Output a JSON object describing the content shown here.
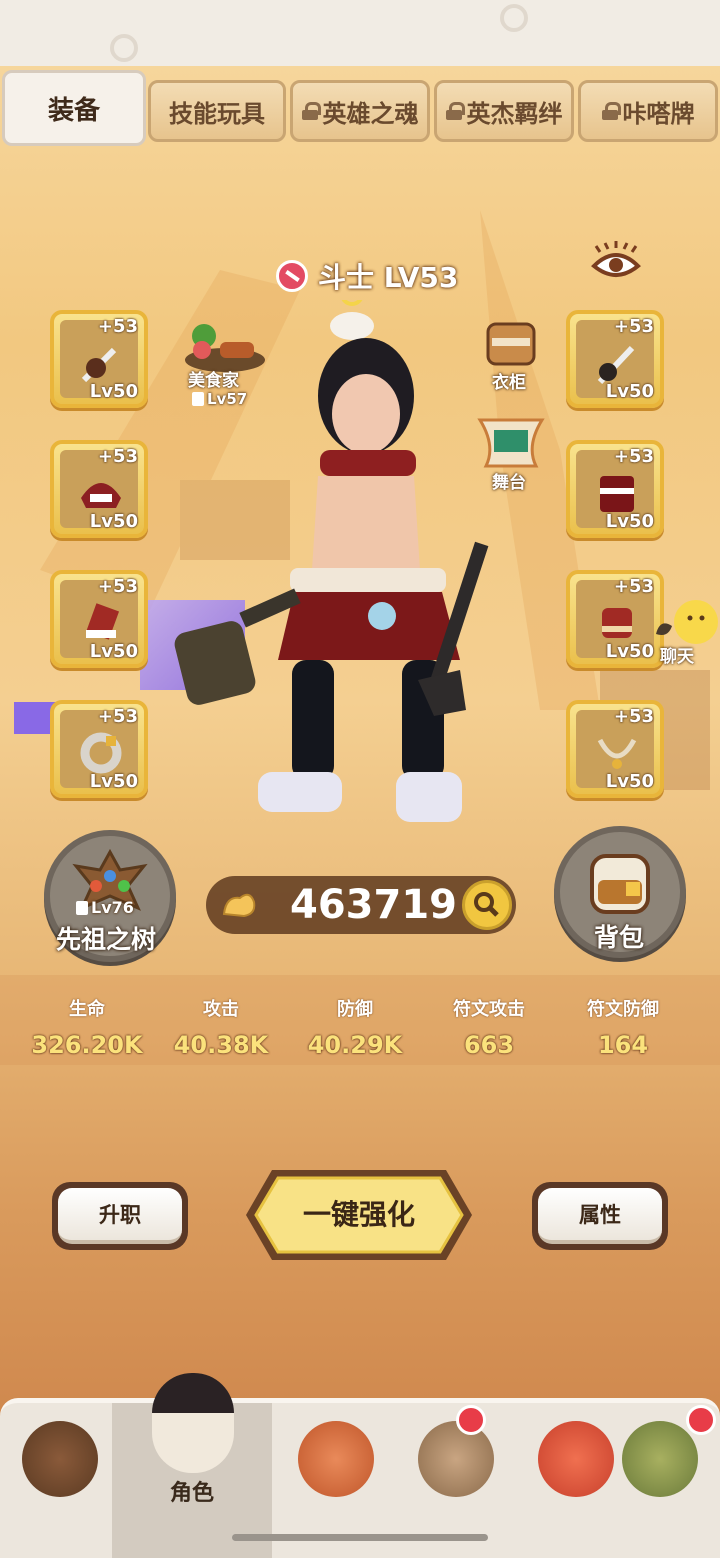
{
  "tabs": [
    {
      "label": "装备",
      "locked": false,
      "active": true
    },
    {
      "label": "技能玩具",
      "locked": false,
      "active": false
    },
    {
      "label": "英雄之魂",
      "locked": true,
      "active": false
    },
    {
      "label": "英杰羁绊",
      "locked": true,
      "active": false
    },
    {
      "label": "咔嗒牌",
      "locked": true,
      "active": false
    }
  ],
  "hero": {
    "class_level": "斗士 LV53"
  },
  "left_slots": [
    {
      "plus": "+53",
      "level": "Lv50",
      "icon": "mace-icon"
    },
    {
      "plus": "+53",
      "level": "Lv50",
      "icon": "helmet-icon"
    },
    {
      "plus": "+53",
      "level": "Lv50",
      "icon": "boots-icon"
    },
    {
      "plus": "+53",
      "level": "Lv50",
      "icon": "ring-icon"
    }
  ],
  "right_slots": [
    {
      "plus": "+53",
      "level": "Lv50",
      "icon": "axe-icon"
    },
    {
      "plus": "+53",
      "level": "Lv50",
      "icon": "armor-icon"
    },
    {
      "plus": "+53",
      "level": "Lv50",
      "icon": "gauntlet-icon"
    },
    {
      "plus": "+53",
      "level": "Lv50",
      "icon": "amulet-icon"
    }
  ],
  "side_features": {
    "gourmet": {
      "label": "美食家",
      "lock_level": "Lv57"
    },
    "wardrobe": {
      "label": "衣柜"
    },
    "stage": {
      "label": "舞台"
    },
    "chat": {
      "label": "聊天"
    }
  },
  "ancestor_tree": {
    "label": "先祖之树",
    "lock_level": "Lv76"
  },
  "backpack": {
    "label": "背包"
  },
  "power": {
    "value": "463719"
  },
  "stats": [
    {
      "key": "生命",
      "value": "326.20K"
    },
    {
      "key": "攻击",
      "value": "40.38K"
    },
    {
      "key": "防御",
      "value": "40.29K"
    },
    {
      "key": "符文攻击",
      "value": "663"
    },
    {
      "key": "符文防御",
      "value": "164"
    }
  ],
  "buttons": {
    "promote": "升职",
    "enhance_all": "一键强化",
    "attributes": "属性"
  },
  "bottom_nav": [
    {
      "label": "",
      "icon": "bear-icon",
      "badge": false,
      "active": false
    },
    {
      "label": "角色",
      "icon": "character-icon",
      "badge": false,
      "active": true
    },
    {
      "label": "",
      "icon": "totem-icon",
      "badge": false,
      "active": false
    },
    {
      "label": "",
      "icon": "elder-icon",
      "badge": true,
      "active": false
    },
    {
      "label": "",
      "icon": "dino-icon",
      "badge": false,
      "active": false
    },
    {
      "label": "",
      "icon": "tribe-icon",
      "badge": true,
      "active": false
    }
  ],
  "colors": {
    "accent": "#f1c640",
    "badge": "#e83c48",
    "slot_border": "#e9b53a"
  }
}
